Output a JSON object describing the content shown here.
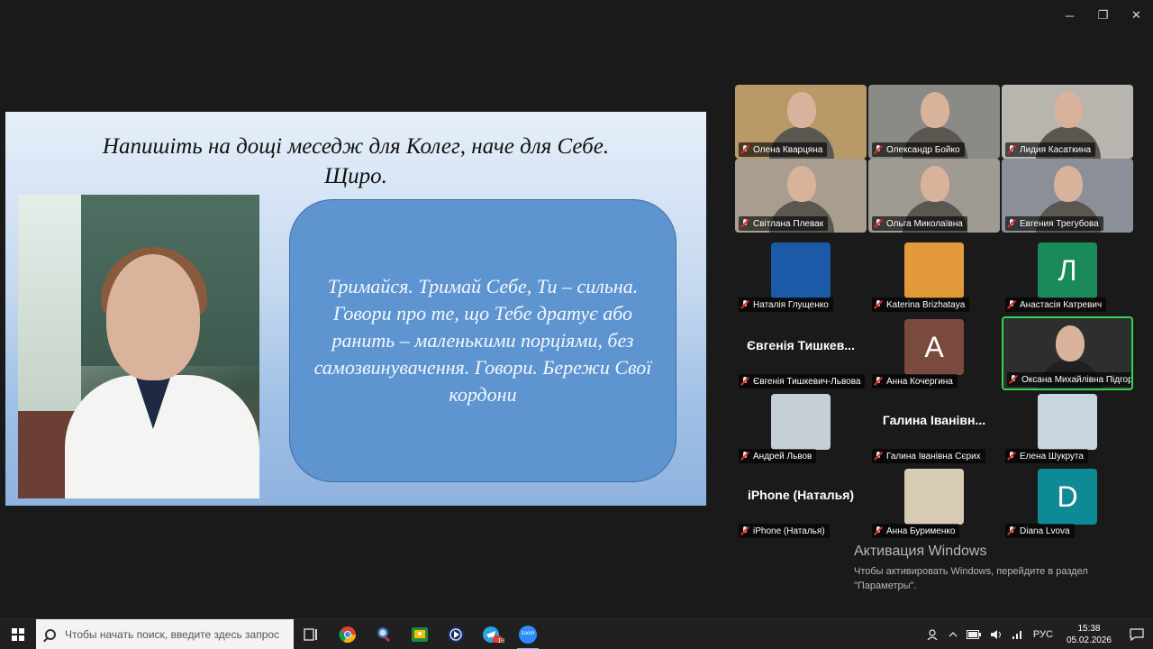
{
  "window_controls": {
    "minimize": "─",
    "restore": "❐",
    "close": "✕"
  },
  "slide": {
    "title_line1": "Напишіть на дощі меседж для Колег, наче для Себе.",
    "title_line2": "Щиро.",
    "bubble_text": "Тримайся. Тримай Себе, Ти – сильна. Говори про те, що Тебе дратує або ранить – маленькими порціями, без самозвинувачення. Говори. Бережи Свої кордони"
  },
  "participants": [
    {
      "label": "Олена Кварцяна",
      "kind": "video",
      "bg": "#b89968"
    },
    {
      "label": "Олександр Бойко",
      "kind": "video",
      "bg": "#8a8a86"
    },
    {
      "label": "Лидия Касаткина",
      "kind": "video",
      "bg": "#b8b4ae"
    },
    {
      "label": "Світлана Плевак",
      "kind": "video",
      "bg": "#a89d8e"
    },
    {
      "label": "Ольга Миколаївна",
      "kind": "video",
      "bg": "#9f9a92"
    },
    {
      "label": "Евгения Трегубова",
      "kind": "video",
      "bg": "#8b8f97"
    },
    {
      "label": "Наталія Глущенко",
      "kind": "avatar",
      "bg": "#1c5aa8"
    },
    {
      "label": "Katerina Brizhataya",
      "kind": "avatar",
      "bg": "#e39a3a"
    },
    {
      "label": "Анастасія Катревич",
      "kind": "avatar",
      "bg": "#1a8a5a",
      "letter": "Л"
    },
    {
      "label": "Євгенія Тишкевич-Львова",
      "kind": "name",
      "display": "Євгенія Тишкев..."
    },
    {
      "label": "Анна Кочергина",
      "kind": "avatar",
      "bg": "#7a4a3e",
      "letter": "А"
    },
    {
      "label": "Оксана  Михайлівна  Підгорна",
      "kind": "video",
      "bg": "#2c2f2e",
      "active": true
    },
    {
      "label": "Андрей Львов",
      "kind": "avatar",
      "bg": "#c7cfd6"
    },
    {
      "label": "Галина Іванівна Сєрих",
      "kind": "name",
      "display": "Галина Іванівн..."
    },
    {
      "label": "Елена Шукрута",
      "kind": "avatar",
      "bg": "#c6d5de"
    },
    {
      "label": "iPhone (Наталья)",
      "kind": "name",
      "display": "iPhone (Наталья)"
    },
    {
      "label": "Анна Бурименко",
      "kind": "avatar",
      "bg": "#d8cbb4"
    },
    {
      "label": "Diana Lvova",
      "kind": "avatar",
      "bg": "#0e8a96",
      "letter": "D"
    }
  ],
  "activation": {
    "title": "Активация Windows",
    "line1": "Чтобы активировать Windows, перейдите в раздел",
    "line2": "\"Параметры\"."
  },
  "taskbar": {
    "search_placeholder": "Чтобы начать поиск, введите здесь запрос",
    "apps": [
      "task-view",
      "chrome",
      "search-app",
      "classroom",
      "media-player",
      "telegram",
      "zoom"
    ],
    "zoom_label": "zoom",
    "telegram_badge": "18",
    "lang": "РУС",
    "time": "15:38",
    "date": "05.02.2026"
  }
}
